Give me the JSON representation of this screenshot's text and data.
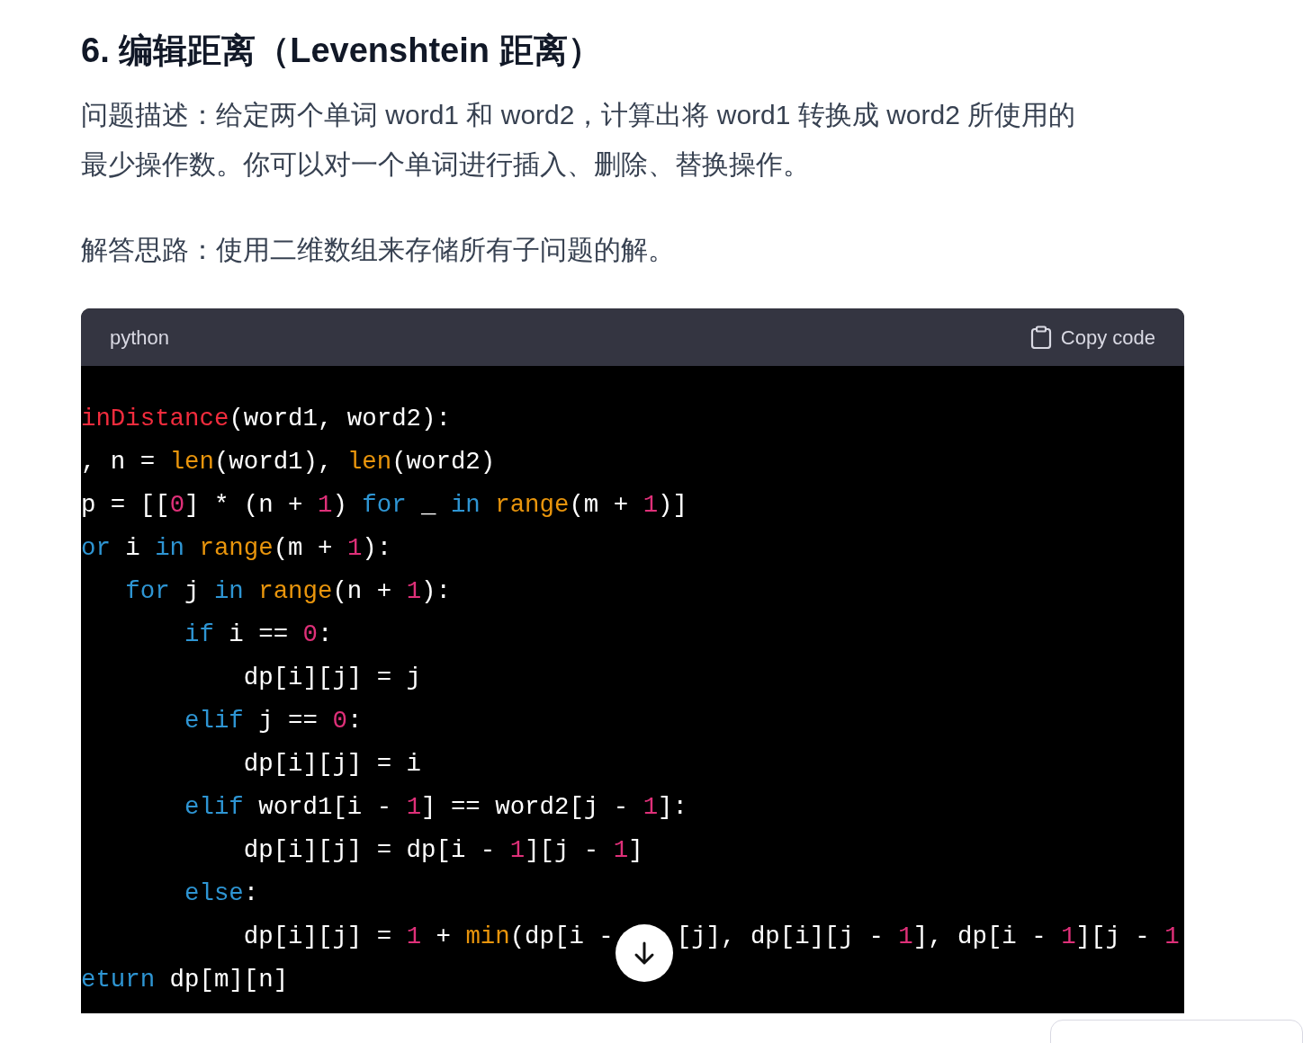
{
  "heading": "6. 编辑距离（Levenshtein 距离）",
  "paragraphs": [
    "问题描述：给定两个单词 word1 和 word2，计算出将 word1 转换成 word2 所使用的最少操作数。你可以对一个单词进行插入、删除、替换操作。",
    "解答思路：使用二维数组来存储所有子问题的解。"
  ],
  "code_block": {
    "language": "python",
    "copy_label": "Copy code",
    "lines": [
      [
        [
          {
            "text": "inDistance",
            "kind": "function"
          },
          {
            "text": "(word1, word2):",
            "kind": "plain"
          }
        ]
      ],
      [
        [
          {
            "text": ", n = ",
            "kind": "plain"
          },
          {
            "text": "len",
            "kind": "builtin"
          },
          {
            "text": "(word1), ",
            "kind": "plain"
          },
          {
            "text": "len",
            "kind": "builtin"
          },
          {
            "text": "(word2)",
            "kind": "plain"
          }
        ]
      ],
      [
        [
          {
            "text": "p = [[",
            "kind": "plain"
          },
          {
            "text": "0",
            "kind": "number"
          },
          {
            "text": "] * (n + ",
            "kind": "plain"
          },
          {
            "text": "1",
            "kind": "number"
          },
          {
            "text": ") ",
            "kind": "plain"
          },
          {
            "text": "for",
            "kind": "keyword"
          },
          {
            "text": " _ ",
            "kind": "plain"
          },
          {
            "text": "in ",
            "kind": "keyword"
          },
          {
            "text": "range",
            "kind": "builtin"
          },
          {
            "text": "(m + ",
            "kind": "plain"
          },
          {
            "text": "1",
            "kind": "number"
          },
          {
            "text": ")]",
            "kind": "plain"
          }
        ]
      ],
      [
        [
          {
            "text": "or",
            "kind": "keyword"
          },
          {
            "text": " i ",
            "kind": "plain"
          },
          {
            "text": "in ",
            "kind": "keyword"
          },
          {
            "text": "range",
            "kind": "builtin"
          },
          {
            "text": "(m + ",
            "kind": "plain"
          },
          {
            "text": "1",
            "kind": "number"
          },
          {
            "text": "):",
            "kind": "plain"
          }
        ]
      ],
      [
        [
          {
            "text": "   for",
            "kind": "keyword"
          },
          {
            "text": " j ",
            "kind": "plain"
          },
          {
            "text": "in ",
            "kind": "keyword"
          },
          {
            "text": "range",
            "kind": "builtin"
          },
          {
            "text": "(n + ",
            "kind": "plain"
          },
          {
            "text": "1",
            "kind": "number"
          },
          {
            "text": "):",
            "kind": "plain"
          }
        ]
      ],
      [
        [
          {
            "text": "       if",
            "kind": "keyword"
          },
          {
            "text": " i == ",
            "kind": "plain"
          },
          {
            "text": "0",
            "kind": "number"
          },
          {
            "text": ":",
            "kind": "plain"
          }
        ]
      ],
      [
        [
          {
            "text": "           dp[i][j] = j",
            "kind": "plain"
          }
        ]
      ],
      [
        [
          {
            "text": "       elif",
            "kind": "keyword"
          },
          {
            "text": " j == ",
            "kind": "plain"
          },
          {
            "text": "0",
            "kind": "number"
          },
          {
            "text": ":",
            "kind": "plain"
          }
        ]
      ],
      [
        [
          {
            "text": "           dp[i][j] = i",
            "kind": "plain"
          }
        ]
      ],
      [
        [
          {
            "text": "       elif",
            "kind": "keyword"
          },
          {
            "text": " word1[i - ",
            "kind": "plain"
          },
          {
            "text": "1",
            "kind": "number"
          },
          {
            "text": "] == word2[j - ",
            "kind": "plain"
          },
          {
            "text": "1",
            "kind": "number"
          },
          {
            "text": "]:",
            "kind": "plain"
          }
        ]
      ],
      [
        [
          {
            "text": "           dp[i][j] = dp[i - ",
            "kind": "plain"
          },
          {
            "text": "1",
            "kind": "number"
          },
          {
            "text": "][j - ",
            "kind": "plain"
          },
          {
            "text": "1",
            "kind": "number"
          },
          {
            "text": "]",
            "kind": "plain"
          }
        ]
      ],
      [
        [
          {
            "text": "       else",
            "kind": "keyword"
          },
          {
            "text": ":",
            "kind": "plain"
          }
        ]
      ],
      [
        [
          {
            "text": "           dp[i][j] = ",
            "kind": "plain"
          },
          {
            "text": "1",
            "kind": "number"
          },
          {
            "text": " + ",
            "kind": "plain"
          },
          {
            "text": "min",
            "kind": "builtin"
          },
          {
            "text": "(dp[i -",
            "kind": "plain"
          }
        ],
        [
          {
            "text": "[j], dp[i][j - ",
            "kind": "plain"
          },
          {
            "text": "1",
            "kind": "number"
          },
          {
            "text": "], dp[i - ",
            "kind": "plain"
          },
          {
            "text": "1",
            "kind": "number"
          },
          {
            "text": "][j - ",
            "kind": "plain"
          },
          {
            "text": "1",
            "kind": "number"
          }
        ]
      ],
      [
        [
          {
            "text": "eturn",
            "kind": "keyword"
          },
          {
            "text": " dp[m][n]",
            "kind": "plain"
          }
        ]
      ]
    ]
  }
}
